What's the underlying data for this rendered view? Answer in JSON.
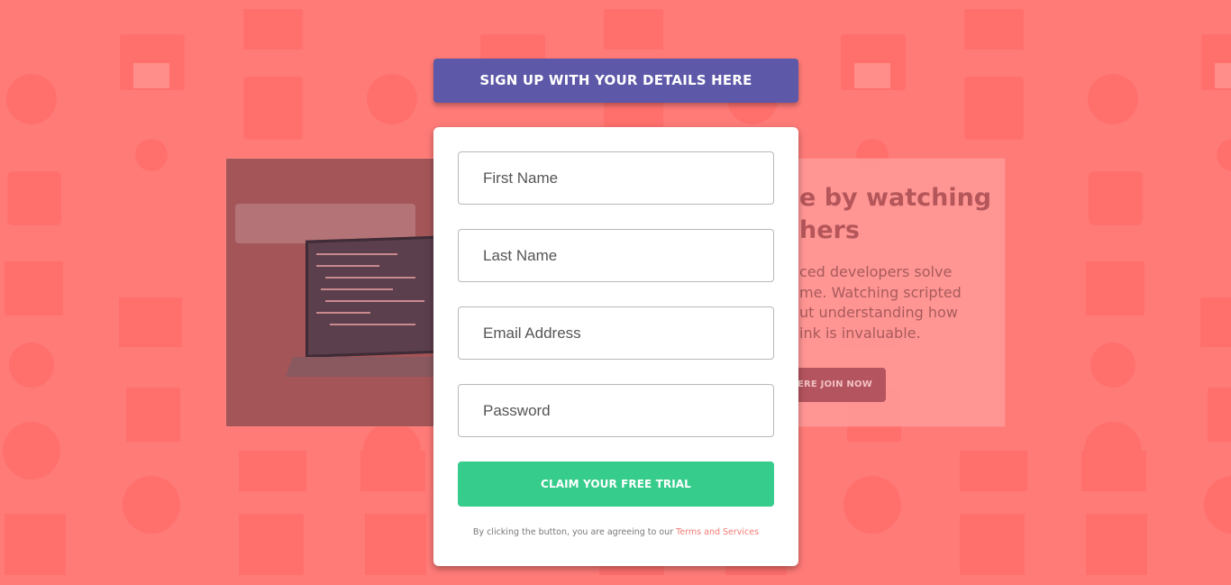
{
  "colors": {
    "background": "#ff7b78",
    "header": "#5d58a8",
    "cta": "#36cc8b",
    "link": "#f07b73"
  },
  "background_card": {
    "heading": "e by watching\nhers",
    "description": "ced developers solve\nme. Watching scripted\nut understanding how\nink is invaluable.",
    "join_label": "ERE JOIN NOW"
  },
  "header": {
    "title": "SIGN UP WITH YOUR DETAILS HERE"
  },
  "form": {
    "first_name": {
      "placeholder": "First Name",
      "value": ""
    },
    "last_name": {
      "placeholder": "Last Name",
      "value": ""
    },
    "email": {
      "placeholder": "Email Address",
      "value": ""
    },
    "password": {
      "placeholder": "Password",
      "value": ""
    },
    "submit_label": "CLAIM YOUR FREE TRIAL",
    "disclaimer_prefix": "By clicking the button, you are agreeing to our ",
    "terms_label": "Terms and Services"
  },
  "icons": [
    "chart-icon",
    "phone-icon",
    "browser-icon",
    "toolbox-icon",
    "headset-icon",
    "network-icon",
    "thumbs-up-icon",
    "rocket-icon",
    "cart-icon",
    "globe-icon",
    "lifebuoy-icon",
    "calendar-icon"
  ]
}
